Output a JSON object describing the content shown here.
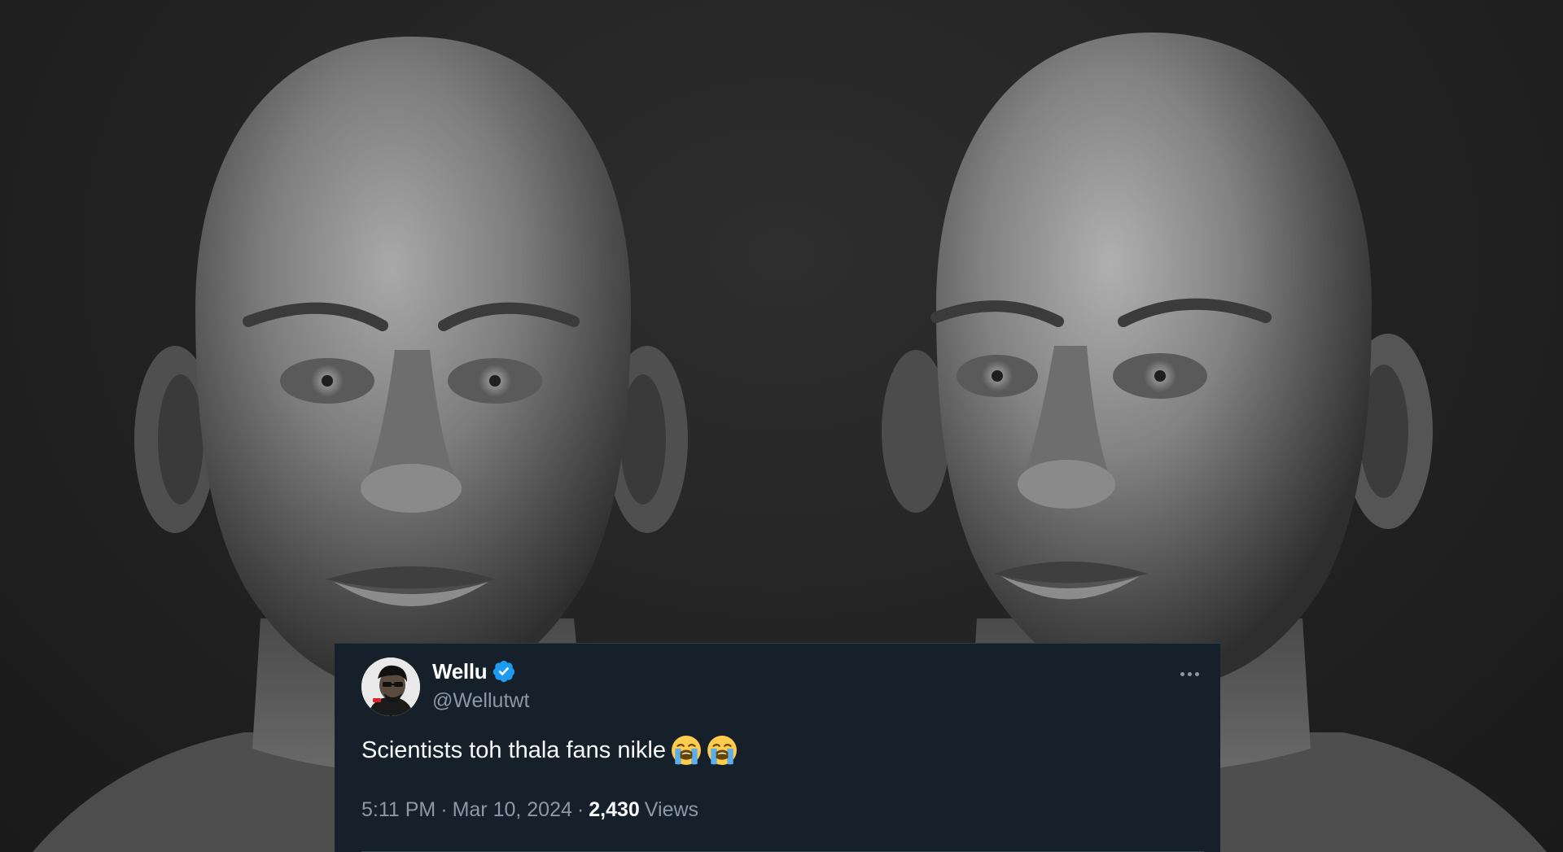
{
  "tweet": {
    "display_name": "Wellu",
    "handle": "@Wellutwt",
    "text": "Scientists toh thala fans nikle",
    "emojis": [
      "loudly-crying-face",
      "loudly-crying-face"
    ],
    "time": "5:11 PM",
    "separator": "·",
    "date": "Mar 10, 2024",
    "views_count": "2,430",
    "views_label": "Views",
    "verified_color": "#1d9bf0"
  },
  "colors": {
    "card_background": "#15202b",
    "secondary_text": "#8b98a5",
    "primary_text": "#f7f9f9"
  }
}
